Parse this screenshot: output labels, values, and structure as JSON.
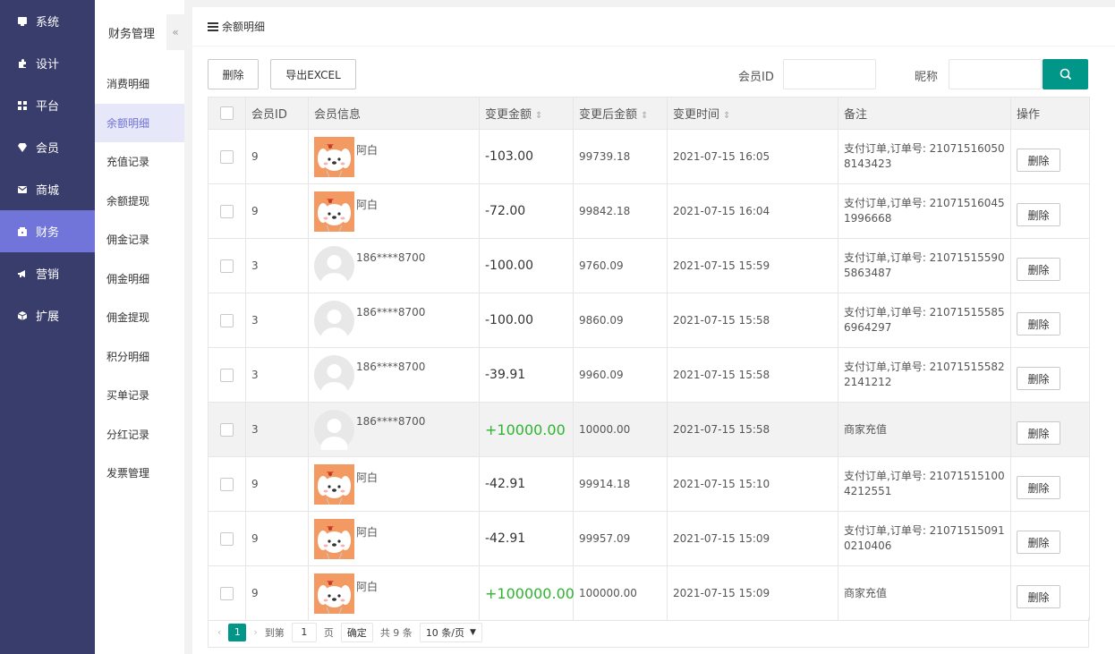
{
  "sidebar": {
    "items": [
      {
        "label": "系统",
        "icon": "monitor-icon"
      },
      {
        "label": "设计",
        "icon": "puzzle-icon"
      },
      {
        "label": "平台",
        "icon": "grid-icon"
      },
      {
        "label": "会员",
        "icon": "diamond-icon"
      },
      {
        "label": "商城",
        "icon": "mail-icon"
      },
      {
        "label": "财务",
        "icon": "wallet-icon"
      },
      {
        "label": "营销",
        "icon": "megaphone-icon"
      },
      {
        "label": "扩展",
        "icon": "cube-icon"
      }
    ],
    "active_index": 5
  },
  "subnav": {
    "title": "财务管理",
    "collapse_glyph": "«",
    "items": [
      "消费明细",
      "余额明细",
      "充值记录",
      "余额提现",
      "佣金记录",
      "佣金明细",
      "佣金提现",
      "积分明细",
      "买单记录",
      "分红记录",
      "发票管理"
    ],
    "active_index": 1
  },
  "panel": {
    "title": "余额明细"
  },
  "toolbar": {
    "delete_label": "删除",
    "export_label": "导出EXCEL",
    "member_id_label": "会员ID",
    "member_id_value": "",
    "nickname_label": "昵称",
    "nickname_value": ""
  },
  "table": {
    "headers": {
      "member_id": "会员ID",
      "member_info": "会员信息",
      "change_amount": "变更金额",
      "after_amount": "变更后金额",
      "change_time": "变更时间",
      "remark": "备注",
      "action": "操作"
    },
    "delete_label": "删除",
    "rows": [
      {
        "id": "9",
        "name": "阿白",
        "avatar": "dog",
        "amount": "-103.00",
        "after": "99739.18",
        "time": "2021-07-15 16:05",
        "remark": "支付订单,订单号: 210715160508143423",
        "positive": false
      },
      {
        "id": "9",
        "name": "阿白",
        "avatar": "dog",
        "amount": "-72.00",
        "after": "99842.18",
        "time": "2021-07-15 16:04",
        "remark": "支付订单,订单号: 210715160451996668",
        "positive": false
      },
      {
        "id": "3",
        "name": "186****8700",
        "avatar": "default",
        "amount": "-100.00",
        "after": "9760.09",
        "time": "2021-07-15 15:59",
        "remark": "支付订单,订单号: 210715155905863487",
        "positive": false
      },
      {
        "id": "3",
        "name": "186****8700",
        "avatar": "default",
        "amount": "-100.00",
        "after": "9860.09",
        "time": "2021-07-15 15:58",
        "remark": "支付订单,订单号: 210715155856964297",
        "positive": false
      },
      {
        "id": "3",
        "name": "186****8700",
        "avatar": "default",
        "amount": "-39.91",
        "after": "9960.09",
        "time": "2021-07-15 15:58",
        "remark": "支付订单,订单号: 210715155822141212",
        "positive": false
      },
      {
        "id": "3",
        "name": "186****8700",
        "avatar": "default",
        "amount": "+10000.00",
        "after": "10000.00",
        "time": "2021-07-15 15:58",
        "remark": "商家充值",
        "positive": true,
        "highlight": true
      },
      {
        "id": "9",
        "name": "阿白",
        "avatar": "dog",
        "amount": "-42.91",
        "after": "99914.18",
        "time": "2021-07-15 15:10",
        "remark": "支付订单,订单号: 210715151004212551",
        "positive": false
      },
      {
        "id": "9",
        "name": "阿白",
        "avatar": "dog",
        "amount": "-42.91",
        "after": "99957.09",
        "time": "2021-07-15 15:09",
        "remark": "支付订单,订单号: 210715150910210406",
        "positive": false
      },
      {
        "id": "9",
        "name": "阿白",
        "avatar": "dog",
        "amount": "+100000.00",
        "after": "100000.00",
        "time": "2021-07-15 15:09",
        "remark": "商家充值",
        "positive": true
      }
    ]
  },
  "pager": {
    "current_page": "1",
    "goto_label": "到第",
    "goto_value": "1",
    "page_unit": "页",
    "confirm_label": "确定",
    "total_label": "共 9 条",
    "page_size_label": "10 条/页"
  },
  "colors": {
    "sidebar_bg": "#393d6b",
    "sidebar_active": "#7174d8",
    "accent": "#009688",
    "positive": "#2fb42f"
  }
}
